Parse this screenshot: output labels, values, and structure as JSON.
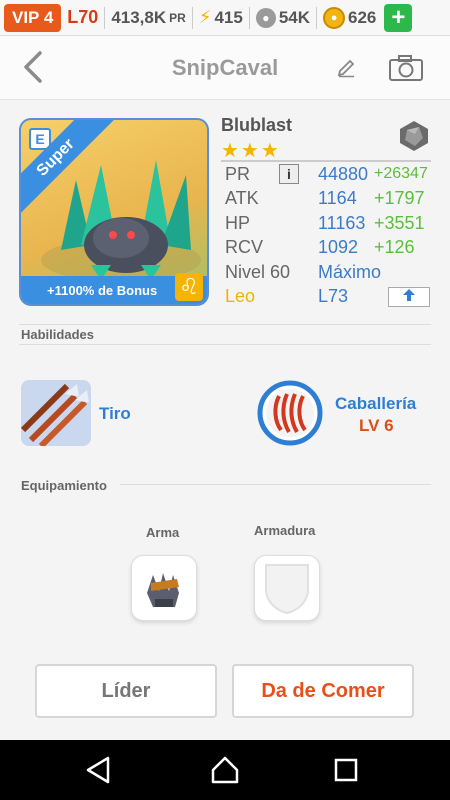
{
  "topbar": {
    "vip": "VIP 4",
    "level": "L70",
    "power": "413,8K",
    "power_suffix": "PR",
    "energy": "415",
    "paws": "54K",
    "coins": "626",
    "add_label": "+"
  },
  "header": {
    "title": "SnipCaval",
    "back_icon": "chevron-left-icon",
    "edit_icon": "pencil-icon",
    "camera_icon": "camera-icon"
  },
  "creature": {
    "rarity": "Super",
    "rarity_tag": "E",
    "bonus": "+1100% de Bonus",
    "zodiac_symbol": "♌",
    "name": "Blublast",
    "stars": "★★★",
    "element_icon": "rock-hexagon-icon"
  },
  "stats": {
    "pr_label": "PR",
    "pr_value": "44880",
    "pr_bonus": "+26347",
    "info_label": "i",
    "atk_label": "ATK",
    "atk_value": "1164",
    "atk_bonus": "+1797",
    "hp_label": "HP",
    "hp_value": "11163",
    "hp_bonus": "+3551",
    "rcv_label": "RCV",
    "rcv_value": "1092",
    "rcv_bonus": "+126",
    "level_label": "Nivel 60",
    "level_value": "Máximo",
    "sign_label": "Leo",
    "sign_value": "L73",
    "upgrade_icon": "up-arrow-icon"
  },
  "skills": {
    "title": "Habilidades",
    "skill1_name": "Tiro",
    "skill2_name": "Caballería",
    "skill2_level": "LV 6"
  },
  "equipment": {
    "title": "Equipamiento",
    "weapon_label": "Arma",
    "armor_label": "Armadura"
  },
  "actions": {
    "leader": "Líder",
    "feed": "Da de Comer"
  },
  "colors": {
    "accent_blue": "#3b8fe0",
    "accent_orange": "#e8501a",
    "bonus_green": "#5cbd3d",
    "star_gold": "#f5b400"
  }
}
